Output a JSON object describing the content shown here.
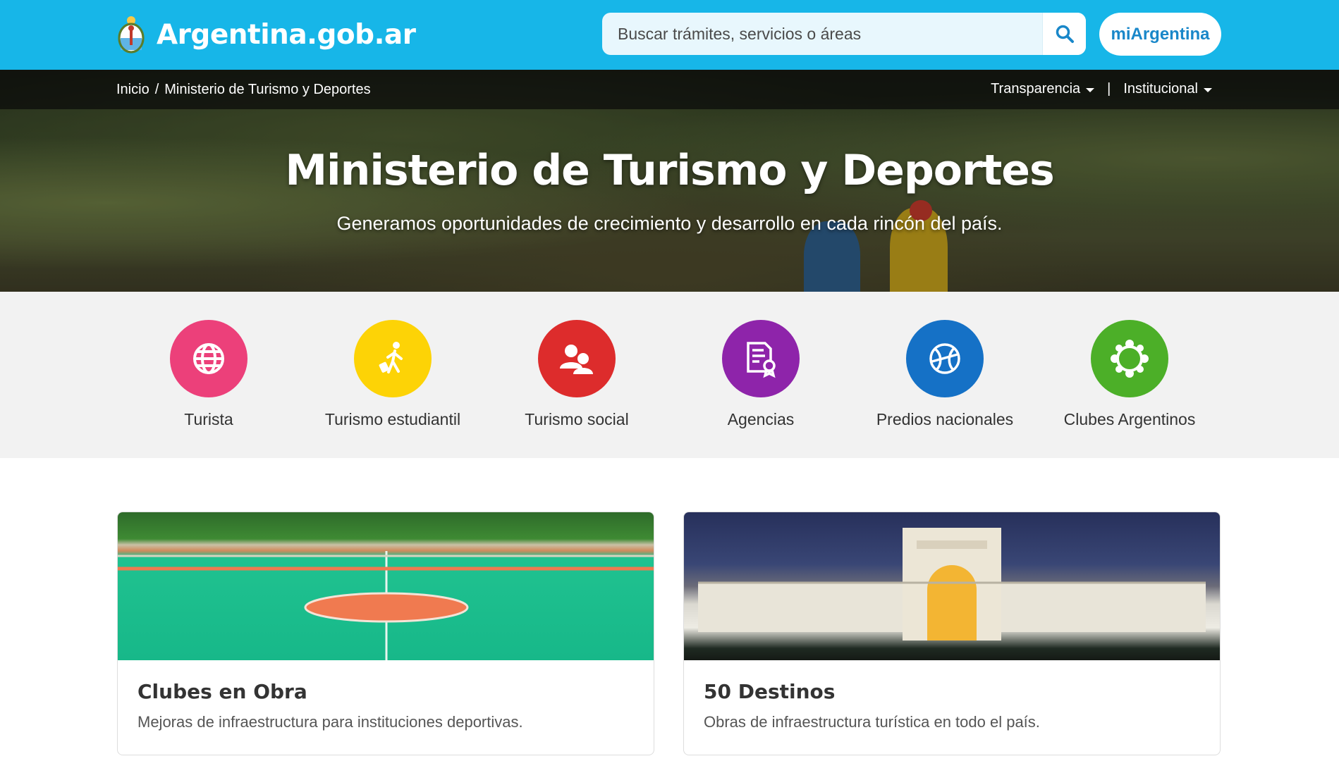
{
  "header": {
    "logo_text": "Argentina.gob.ar",
    "search_placeholder": "Buscar trámites, servicios o áreas",
    "mi_button": "miArgentina",
    "colors": {
      "primary": "#17b6e8",
      "accent": "#1987c9"
    }
  },
  "breadcrumb": {
    "home": "Inicio",
    "separator": "/",
    "current": "Ministerio de Turismo y Deportes"
  },
  "top_menu": {
    "transparencia": "Transparencia",
    "separator": "|",
    "institucional": "Institucional"
  },
  "hero": {
    "title": "Ministerio de Turismo y Deportes",
    "subtitle": "Generamos oportunidades de crecimiento y desarrollo en cada rincón del país."
  },
  "categories": [
    {
      "label": "Turista",
      "icon": "globe-icon",
      "color": "#ec407a"
    },
    {
      "label": "Turismo estudiantil",
      "icon": "traveler-icon",
      "color": "#fdd306"
    },
    {
      "label": "Turismo social",
      "icon": "people-icon",
      "color": "#dd2c2c"
    },
    {
      "label": "Agencias",
      "icon": "certificate-icon",
      "color": "#8e24aa"
    },
    {
      "label": "Predios nacionales",
      "icon": "ball-icon",
      "color": "#1571c6"
    },
    {
      "label": "Clubes Argentinos",
      "icon": "community-icon",
      "color": "#4caf28"
    }
  ],
  "cards": [
    {
      "title": "Clubes en Obra",
      "text": "Mejoras de infraestructura para instituciones deportivas."
    },
    {
      "title": "50 Destinos",
      "text": "Obras de infraestructura turística en todo el país."
    }
  ]
}
